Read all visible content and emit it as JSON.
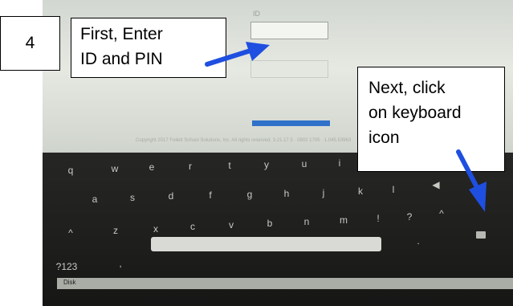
{
  "login": {
    "id_label": "ID",
    "copyright": "Copyright 2017 Follett School Solutions, Inc. All rights reserved. 3.21.17.5 · 0802 1705 · 1.045.53963"
  },
  "keyboard": {
    "row1": [
      "q",
      "w",
      "e",
      "r",
      "t",
      "y",
      "u",
      "i"
    ],
    "row2": [
      "a",
      "s",
      "d",
      "f",
      "g",
      "h",
      "j",
      "k",
      "l"
    ],
    "row3": [
      "^",
      "z",
      "x",
      "c",
      "v",
      "b",
      "n",
      "m",
      "!",
      "?",
      "^"
    ],
    "bottom_left": "?123",
    "bottom_comma": ",",
    "period": ".",
    "keyboard_icon": "keyboard-icon"
  },
  "status_bar": {
    "label": "Disk"
  },
  "annotations": {
    "step_number": "4",
    "first_lines": [
      "First, Enter",
      "ID and PIN"
    ],
    "next_lines": [
      "Next, click",
      "on keyboard",
      "icon"
    ],
    "arrow_color": "#1f4fe0"
  }
}
